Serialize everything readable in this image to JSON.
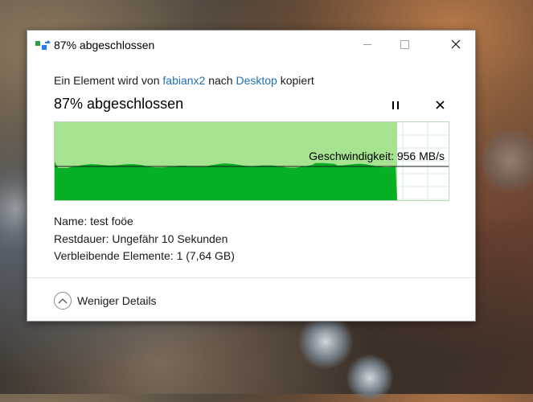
{
  "dialog": {
    "title": "87% abgeschlossen",
    "copy_prefix": "Ein Element wird von",
    "source": "fabianx2",
    "copy_middle": "nach",
    "destination": "Desktop",
    "copy_suffix": "kopiert",
    "progress_title": "87% abgeschlossen",
    "progress_percent": 87,
    "speed_label": "Geschwindigkeit: 956 MB/s",
    "details": {
      "name_label": "Name:",
      "name_value": "test foöe",
      "remaining_label": "Restdauer:",
      "remaining_value": "Ungefähr 10 Sekunden",
      "items_label": "Verbleibende Elemente:",
      "items_value": "1 (7,64 GB)"
    },
    "less_details_label": "Weniger Details"
  },
  "icons": {
    "app": "copy-transfer-icon",
    "minimize": "minimize-icon",
    "maximize": "maximize-icon",
    "close": "close-icon",
    "pause": "pause-icon",
    "cancel": "cancel-icon",
    "chevron": "chevron-up-icon"
  },
  "colors": {
    "graph_fill": "#06b025",
    "graph_done_area": "#a5e391",
    "link": "#1f6fb2"
  }
}
